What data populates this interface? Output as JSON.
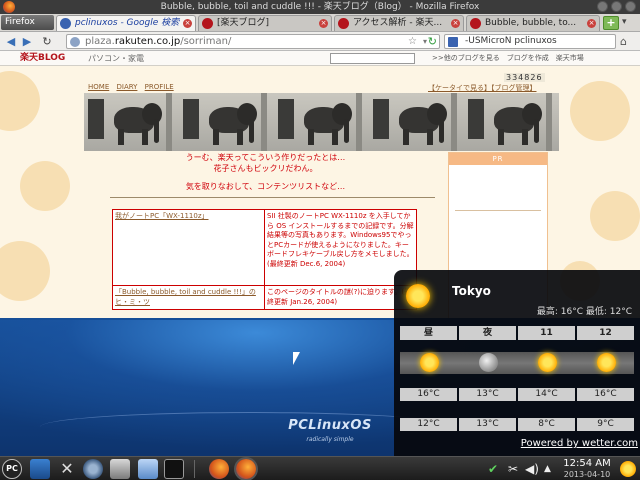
{
  "window": {
    "title": "Bubble,  bubble,  toil and cuddle !!! - 楽天ブログ（Blog） - Mozilla Firefox"
  },
  "tabs": [
    {
      "label": "pclinuxos - Google 検索",
      "active": true,
      "favicon_color": "#3a63b0"
    },
    {
      "label": "[楽天ブログ]",
      "active": false,
      "favicon_color": "#b4141c"
    },
    {
      "label": "アクセス解析 - 楽天...",
      "active": false,
      "favicon_color": "#b4141c"
    },
    {
      "label": "Bubble,  bubble,  to...",
      "active": false,
      "favicon_color": "#b4141c"
    }
  ],
  "firefox_menu": "Firefox",
  "nav": {
    "url_prefix": "plaza.",
    "url_domain": "rakuten.co.jp",
    "url_path": "/sorriman/",
    "search_value": "-USMicroN pclinuxos"
  },
  "rakuten_bar": {
    "logo": "楽天BLOG",
    "category": "パソコン・家電",
    "links": ">>他のブログを見る　ブログを作成　楽天市場"
  },
  "blog": {
    "counter": "334826",
    "menu": [
      "HOME",
      "DIARY",
      "PROFILE"
    ],
    "mobile_links": "【ケータイで見る】【ブログ管理】",
    "message_line1": "うーむ、楽天ってこういう作りだったとは…",
    "message_line2": "花子さんもビックリだわん。",
    "message_line3": "気を取りなおして、コンテンツリストなど…",
    "sidebar_pr": "PR",
    "entries": [
      {
        "title": "我がノートPC「WX-1110z」",
        "desc": "SII 社製のノートPC WX-1110z を入手してから OS インストールするまでの記録です。分解結果等の写真もあります。Windows95でやっとPCカードが使えるようになりました。キーボードフレキケーブル戻し方をメモしました。(最終更新 Dec.6, 2004)"
      },
      {
        "title": "「Bubble,  bubble,  toil and cuddle !!!」のヒ・ミ・ツ",
        "desc": "このページのタイトルの謎(?)に迫ります。(最終更新 Jan.26, 2004)"
      }
    ]
  },
  "weather": {
    "city": "Tokyo",
    "high_low": "最高: 16°C 最低: 12°C",
    "periods": [
      {
        "label": "昼",
        "icon": "sun-icon",
        "high": "16°C",
        "low": "12°C"
      },
      {
        "label": "夜",
        "icon": "moon-icon",
        "high": "13°C",
        "low": "13°C"
      },
      {
        "label": "11",
        "icon": "sun-icon",
        "high": "14°C",
        "low": "8°C"
      },
      {
        "label": "12",
        "icon": "sun-icon",
        "high": "16°C",
        "low": "9°C"
      }
    ],
    "powered": "Powered by wetter.com"
  },
  "desktop": {
    "brand": "PCLinuxOS",
    "tagline": "radically simple"
  },
  "taskbar": {
    "start_label": "PC",
    "time": "12:54 AM",
    "date": "2013-04-10"
  }
}
